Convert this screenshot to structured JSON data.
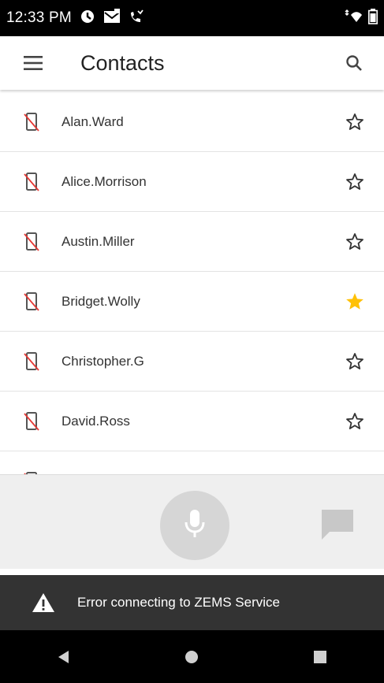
{
  "status_bar": {
    "time": "12:33 PM"
  },
  "app_bar": {
    "title": "Contacts",
    "menu_icon": "hamburger-menu-icon",
    "search_icon": "search-icon"
  },
  "contacts": [
    {
      "name": "Alan.Ward",
      "favorite": false
    },
    {
      "name": "Alice.Morrison",
      "favorite": false
    },
    {
      "name": "Austin.Miller",
      "favorite": false
    },
    {
      "name": "Bridget.Wolly",
      "favorite": true
    },
    {
      "name": "Christopher.G",
      "favorite": false
    },
    {
      "name": "David.Ross",
      "favorite": false
    }
  ],
  "actions": {
    "mic_icon": "microphone-icon",
    "chat_icon": "chat-bubble-icon"
  },
  "snackbar": {
    "icon": "warning-icon",
    "message": "Error connecting to ZEMS Service"
  },
  "nav_bar": {
    "back_icon": "back-triangle-icon",
    "home_icon": "home-circle-icon",
    "recents_icon": "recents-square-icon"
  },
  "colors": {
    "favorite_star": "#FFC107",
    "snackbar_bg": "#333333",
    "action_bar_bg": "#EFEFEF",
    "mic_circle": "#D6D6D6"
  }
}
